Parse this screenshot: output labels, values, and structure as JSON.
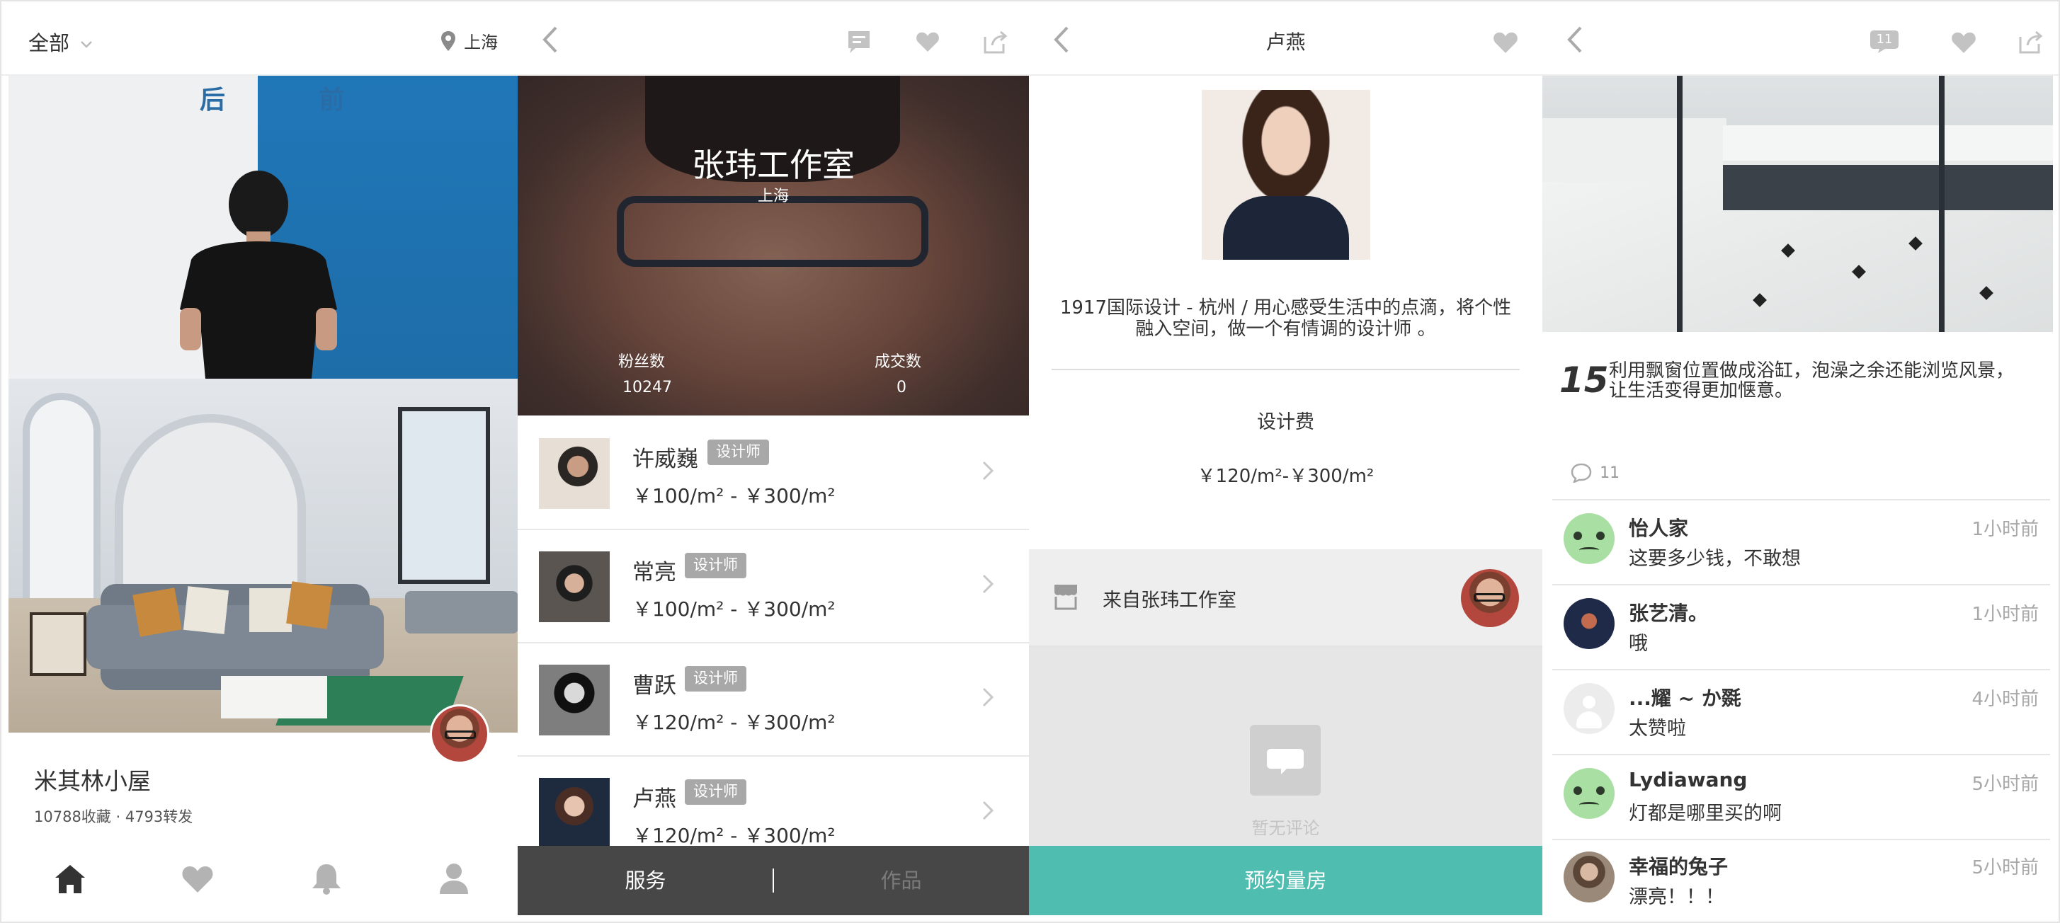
{
  "panel1": {
    "filter_label": "全部",
    "city": "上海",
    "wall_text": "后  前",
    "project_title": "米其林小屋",
    "stats": "10788收藏 · 4793转发",
    "nav": [
      "home-icon",
      "heart-icon",
      "bell-icon",
      "user-icon"
    ]
  },
  "panel2": {
    "studio_name": "张玮工作室",
    "studio_city": "上海",
    "fans_label": "粉丝数",
    "fans_value": "10247",
    "deals_label": "成交数",
    "deals_value": "0",
    "designers": [
      {
        "name": "许威巍",
        "tag": "设计师",
        "price": "￥100/m² - ￥300/m²"
      },
      {
        "name": "常亮",
        "tag": "设计师",
        "price": "￥100/m² - ￥300/m²"
      },
      {
        "name": "曹跃",
        "tag": "设计师",
        "price": "￥120/m² - ￥300/m²"
      },
      {
        "name": "卢燕",
        "tag": "设计师",
        "price": "￥120/m² - ￥300/m²"
      }
    ],
    "tab_service": "服务",
    "tab_works": "作品"
  },
  "panel3": {
    "title": "卢燕",
    "bio": "1917国际设计 - 杭州 / 用心感受生活中的点滴，将个性融入空间，做一个有情调的设计师 。",
    "fee_label": "设计费",
    "fee_value": "￥120/m²-￥300/m²",
    "from_label": "来自张玮工作室",
    "no_comments": "暂无评论",
    "book_button": "预约量房"
  },
  "panel4": {
    "comment_badge": "11",
    "step_number": "15",
    "step_text": "利用飘窗位置做成浴缸，泡澡之余还能浏览风景，让生活变得更加惬意。",
    "comment_count": "11",
    "comments": [
      {
        "user": "怡人家",
        "text": "这要多少钱，不敢想",
        "time": "1小时前"
      },
      {
        "user": "张艺清。",
        "text": "哦",
        "time": "1小时前"
      },
      {
        "user": "...耀 ~ か毲",
        "text": "太赞啦",
        "time": "4小时前"
      },
      {
        "user": "Lydiawang",
        "text": "灯都是哪里买的啊",
        "time": "5小时前"
      },
      {
        "user": "幸福的兔子",
        "text": "漂亮！！！",
        "time": "5小时前"
      }
    ]
  },
  "colors": {
    "accent": "#4fbdaf",
    "dark_bar": "#474747",
    "tag_gray": "#a8a8a8",
    "icon_gray": "#c3c3c3"
  }
}
